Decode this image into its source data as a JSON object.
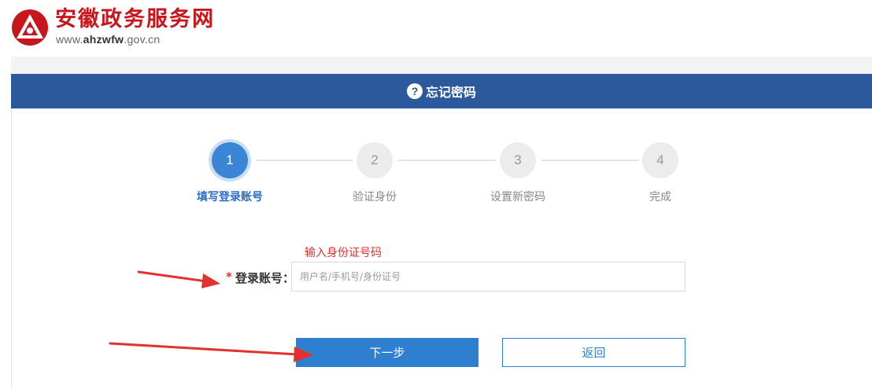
{
  "header": {
    "site_name": "安徽政务服务网",
    "url_prefix": "www.",
    "url_bold": "ahzwfw",
    "url_suffix": ".gov.cn"
  },
  "title_bar": {
    "icon": "question-icon",
    "icon_glyph": "?",
    "title": "忘记密码"
  },
  "steps": [
    {
      "number": "1",
      "label": "填写登录账号",
      "active": true
    },
    {
      "number": "2",
      "label": "验证身份",
      "active": false
    },
    {
      "number": "3",
      "label": "设置新密码",
      "active": false
    },
    {
      "number": "4",
      "label": "完成",
      "active": false
    }
  ],
  "form": {
    "hint": "输入身份证号码",
    "required_mark": "*",
    "account_label": "登录账号：",
    "account_value": "",
    "account_placeholder": "用户名/手机号/身份证号"
  },
  "buttons": {
    "next": "下一步",
    "back": "返回"
  },
  "colors": {
    "brand_red": "#c8161d",
    "title_bar_blue": "#2c589c",
    "primary_blue": "#2f7fd0",
    "annotation_red": "#e0322f"
  }
}
